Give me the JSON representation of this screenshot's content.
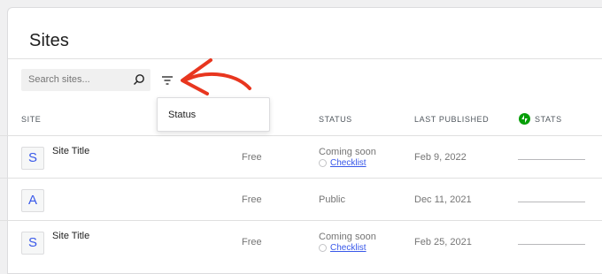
{
  "header": {
    "title": "Sites"
  },
  "search": {
    "placeholder": "Search sites..."
  },
  "filter": {
    "menu_items": [
      "Status"
    ]
  },
  "table": {
    "columns": {
      "site": "SITE",
      "status": "STATUS",
      "last_published": "LAST PUBLISHED",
      "stats": "STATS"
    },
    "rows": [
      {
        "avatar_letter": "S",
        "title": "Site Title",
        "plan": "Free",
        "status": "Coming soon",
        "checklist": "Checklist",
        "last_published": "Feb 9, 2022"
      },
      {
        "avatar_letter": "A",
        "title": "",
        "plan": "Free",
        "status": "Public",
        "checklist": "",
        "last_published": "Dec 11, 2021"
      },
      {
        "avatar_letter": "S",
        "title": "Site Title",
        "plan": "Free",
        "status": "Coming soon",
        "checklist": "Checklist",
        "last_published": "Feb 25, 2021"
      }
    ]
  },
  "colors": {
    "accent": "#3858e9",
    "jetpack_green": "#069e08",
    "annotation_red": "#e8361f"
  }
}
